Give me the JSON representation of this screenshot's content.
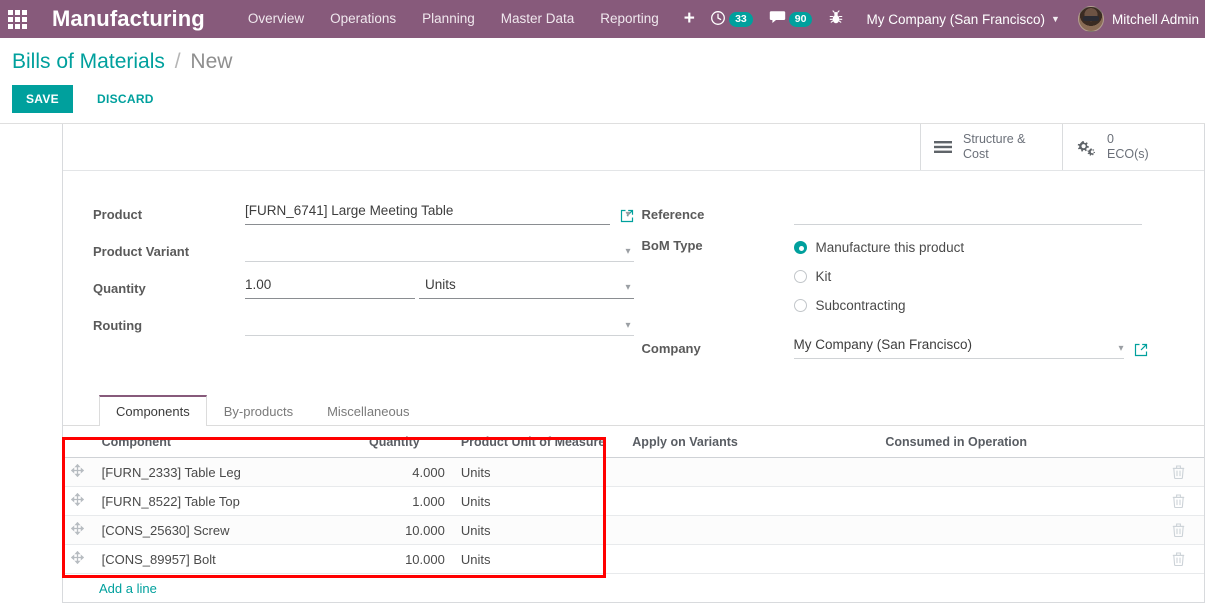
{
  "navbar": {
    "apps_icon": "apps-grid-icon",
    "brand": "Manufacturing",
    "menu_items": [
      {
        "label": "Overview"
      },
      {
        "label": "Operations"
      },
      {
        "label": "Planning"
      },
      {
        "label": "Master Data"
      },
      {
        "label": "Reporting"
      }
    ],
    "add_label": "+",
    "activities": {
      "icon": "clock-icon",
      "count": "33"
    },
    "messages": {
      "icon": "comment-icon",
      "count": "90"
    },
    "debug": {
      "icon": "bug-icon"
    },
    "company": "My Company (San Francisco)",
    "user": "Mitchell Admin",
    "colors": {
      "brand_purple": "#875A7B",
      "accent_teal": "#00A09D"
    }
  },
  "control_panel": {
    "breadcrumb_root": "Bills of Materials",
    "breadcrumb_sep": "/",
    "breadcrumb_current": "New",
    "save_label": "SAVE",
    "discard_label": "DISCARD"
  },
  "smart_buttons": [
    {
      "icon": "list-lines-icon",
      "line1": "Structure &",
      "line2": "Cost"
    },
    {
      "icon": "gears-icon",
      "line1": "0",
      "line2": "ECO(s)"
    }
  ],
  "form": {
    "left": {
      "product_label": "Product",
      "product_value": "[FURN_6741] Large Meeting Table",
      "variant_label": "Product Variant",
      "variant_value": "",
      "quantity_label": "Quantity",
      "quantity_value": "1.00",
      "quantity_uom": "Units",
      "routing_label": "Routing",
      "routing_value": ""
    },
    "right": {
      "reference_label": "Reference",
      "reference_value": "",
      "bom_type_label": "BoM Type",
      "bom_type_options": [
        {
          "label": "Manufacture this product",
          "selected": true
        },
        {
          "label": "Kit",
          "selected": false
        },
        {
          "label": "Subcontracting",
          "selected": false
        }
      ],
      "company_label": "Company",
      "company_value": "My Company (San Francisco)"
    }
  },
  "notebook": {
    "tabs": [
      {
        "label": "Components",
        "active": true
      },
      {
        "label": "By-products",
        "active": false
      },
      {
        "label": "Miscellaneous",
        "active": false
      }
    ],
    "columns": [
      "Component",
      "Quantity",
      "Product Unit of Measure",
      "Apply on Variants",
      "Consumed in Operation"
    ],
    "rows": [
      {
        "component": "[FURN_2333] Table Leg",
        "quantity": "4.000",
        "uom": "Units",
        "variants": "",
        "operation": ""
      },
      {
        "component": "[FURN_8522] Table Top",
        "quantity": "1.000",
        "uom": "Units",
        "variants": "",
        "operation": ""
      },
      {
        "component": "[CONS_25630] Screw",
        "quantity": "10.000",
        "uom": "Units",
        "variants": "",
        "operation": ""
      },
      {
        "component": "[CONS_89957] Bolt",
        "quantity": "10.000",
        "uom": "Units",
        "variants": "",
        "operation": ""
      }
    ],
    "add_line_label": "Add a line"
  },
  "annotation": {
    "color": "#ff0000"
  }
}
